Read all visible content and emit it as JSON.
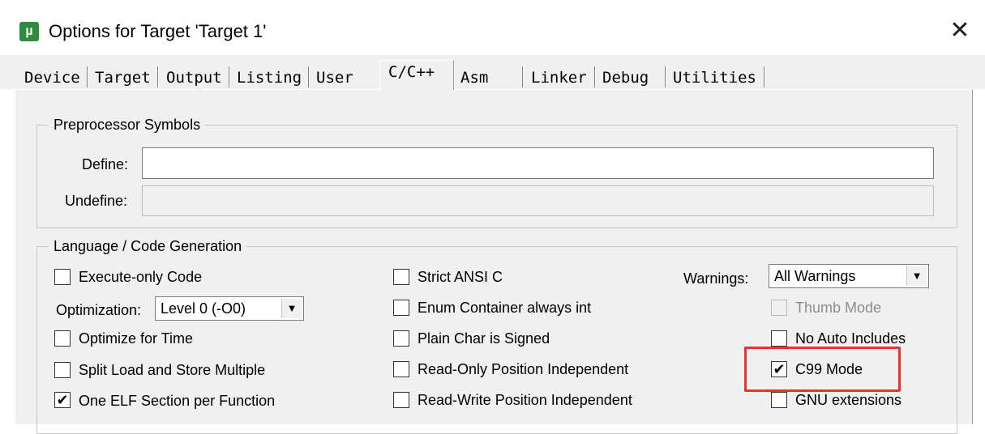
{
  "window": {
    "title": "Options for Target 'Target 1'"
  },
  "tabs": [
    {
      "label": "Device"
    },
    {
      "label": "Target"
    },
    {
      "label": "Output"
    },
    {
      "label": "Listing"
    },
    {
      "label": "User"
    },
    {
      "label": "C/C++"
    },
    {
      "label": "Asm"
    },
    {
      "label": "Linker"
    },
    {
      "label": "Debug"
    },
    {
      "label": "Utilities"
    }
  ],
  "active_tab": "C/C++",
  "preprocessor": {
    "legend": "Preprocessor Symbols",
    "define_label": "Define:",
    "define_value": "",
    "undefine_label": "Undefine:",
    "undefine_value": ""
  },
  "language": {
    "legend": "Language / Code Generation",
    "optimization_label": "Optimization:",
    "optimization_value": "Level 0 (-O0)",
    "warnings_label": "Warnings:",
    "warnings_value": "All Warnings",
    "checkboxes": {
      "execute_only": {
        "label": "Execute-only Code",
        "checked": false
      },
      "optimize_time": {
        "label": "Optimize for Time",
        "checked": false
      },
      "split_load": {
        "label": "Split Load and Store Multiple",
        "checked": false
      },
      "one_elf": {
        "label": "One ELF Section per Function",
        "checked": true
      },
      "strict_ansi": {
        "label": "Strict ANSI C",
        "checked": false
      },
      "enum_container": {
        "label": "Enum Container always int",
        "checked": false
      },
      "plain_char": {
        "label": "Plain Char is Signed",
        "checked": false
      },
      "ropi": {
        "label": "Read-Only Position Independent",
        "checked": false
      },
      "rwpi": {
        "label": "Read-Write Position Independent",
        "checked": false
      },
      "thumb_mode": {
        "label": "Thumb Mode",
        "checked": false,
        "disabled": true
      },
      "no_auto_includes": {
        "label": "No Auto Includes",
        "checked": false
      },
      "c99_mode": {
        "label": "C99 Mode",
        "checked": true
      },
      "gnu_ext": {
        "label": "GNU extensions",
        "checked": false
      }
    }
  },
  "colors": {
    "highlight": "#e8332f",
    "dialog_bg": "#f0f0f0",
    "app_icon": "#2e8b3e"
  },
  "icons": {
    "app": "keil-uvision-icon",
    "close": "close-icon",
    "dropdown": "chevron-down-icon",
    "check": "check-mark-icon"
  }
}
